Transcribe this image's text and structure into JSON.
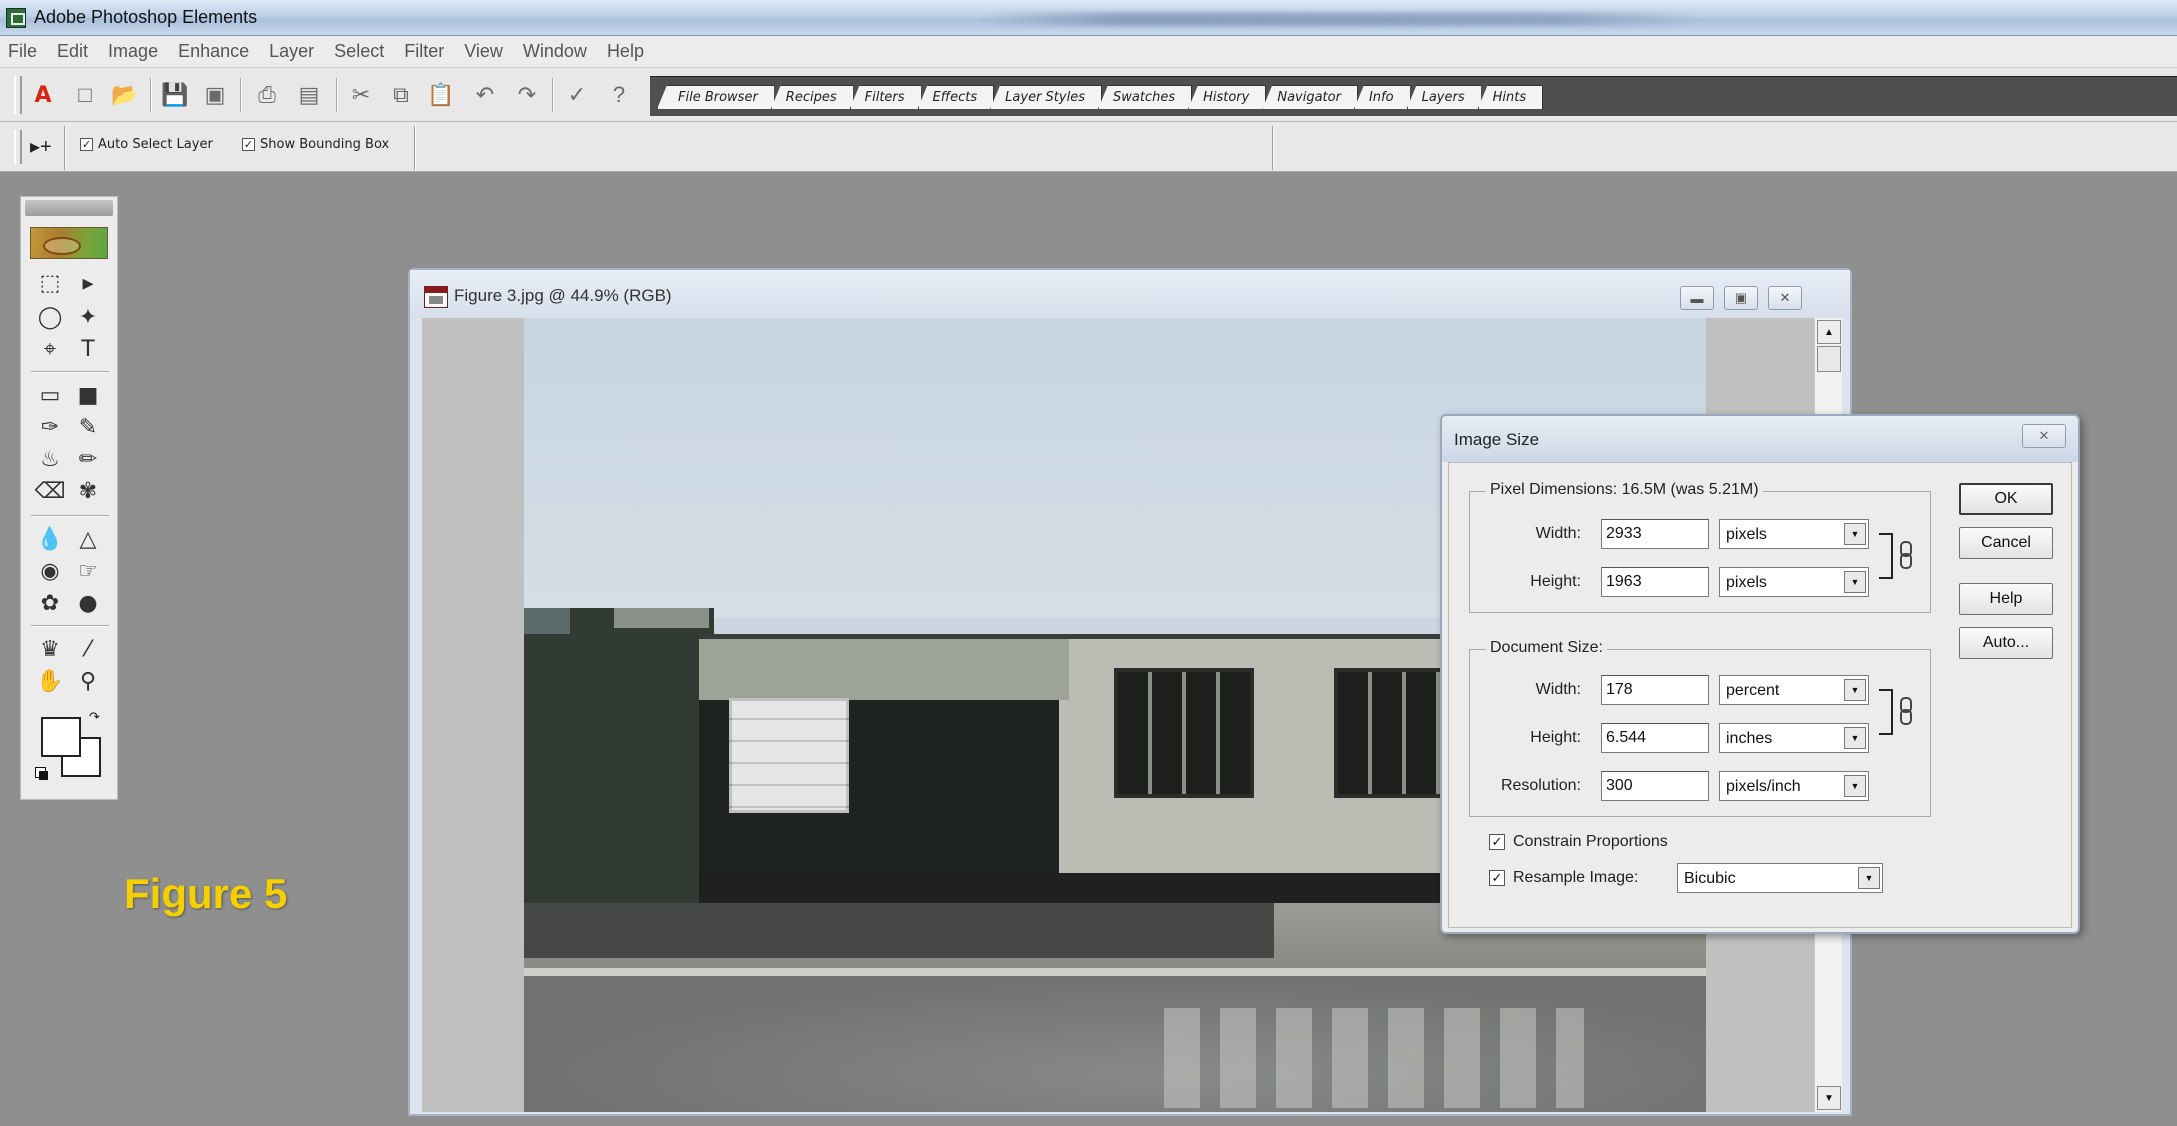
{
  "app": {
    "title": "Adobe Photoshop Elements"
  },
  "menu": [
    "File",
    "Edit",
    "Image",
    "Enhance",
    "Layer",
    "Select",
    "Filter",
    "View",
    "Window",
    "Help"
  ],
  "toolbar": {
    "icons": [
      "adobe-logo-icon",
      "new-file-icon",
      "open-folder-icon",
      "save-icon",
      "save-web-icon",
      "print-icon",
      "print-preview-icon",
      "cut-icon",
      "copy-icon",
      "paste-icon",
      "undo-icon",
      "redo-icon",
      "step-backward-icon",
      "help-icon"
    ]
  },
  "palette_tabs": [
    "File Browser",
    "Recipes",
    "Filters",
    "Effects",
    "Layer Styles",
    "Swatches",
    "History",
    "Navigator",
    "Info",
    "Layers",
    "Hints"
  ],
  "options_bar": {
    "auto_select": "Auto Select Layer",
    "show_bounding": "Show Bounding Box"
  },
  "figure_label": "Figure 5",
  "document": {
    "title": "Figure 3.jpg @ 44.9% (RGB)"
  },
  "dialog": {
    "title": "Image Size",
    "pixel_dimensions_label": "Pixel Dimensions:  16.5M (was 5.21M)",
    "width_label": "Width:",
    "height_label": "Height:",
    "pixel_width": "2933",
    "pixel_height": "1963",
    "pixel_unit_w": "pixels",
    "pixel_unit_h": "pixels",
    "document_size_label": "Document Size:",
    "doc_width": "178",
    "doc_height": "6.544",
    "doc_unit_w": "percent",
    "doc_unit_h": "inches",
    "resolution_label": "Resolution:",
    "resolution": "300",
    "resolution_unit": "pixels/inch",
    "constrain": "Constrain Proportions",
    "resample": "Resample Image:",
    "resample_method": "Bicubic",
    "ok": "OK",
    "cancel": "Cancel",
    "help": "Help",
    "auto": "Auto..."
  }
}
